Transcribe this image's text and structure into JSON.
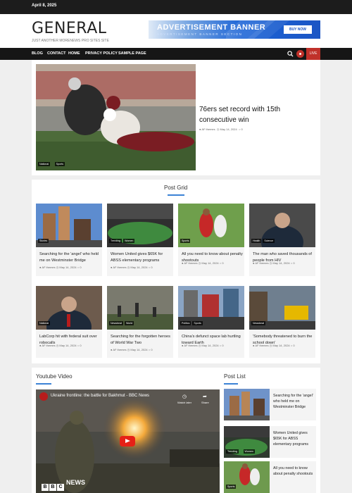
{
  "topbar": {
    "date": "April 8, 2025"
  },
  "header": {
    "logo": "GENERAL",
    "tagline": "Just another morenews pro sites site",
    "ad": {
      "title": "ADVERTISEMENT BANNER",
      "subtitle": "ADVERTISEMENT BANNER SECTION",
      "button": "BUY NOW"
    }
  },
  "nav": {
    "items": [
      "BLOG",
      "CONTACT",
      "HOME",
      "PRIVACY POLICY",
      "SAMPLE PAGE"
    ],
    "live_label": "LIVE"
  },
  "featured": {
    "title": "76ers set record with 15th consecutive win",
    "author": "AF themes",
    "date": "May 14, 2024",
    "comments": "0",
    "tags": [
      "National",
      "Sports"
    ]
  },
  "post_grid": {
    "title": "Post Grid",
    "cards": [
      {
        "title": "Searching for the 'angel' who held me on Westminster Bridge",
        "tags": [
          "Stories"
        ],
        "author": "AF themes",
        "date": "May 14, 2024",
        "comments": "0"
      },
      {
        "title": "Women United gives $65K for ABSS elementary programs",
        "tags": [
          "Trending",
          "Women"
        ],
        "author": "AF themes",
        "date": "May 14, 2024",
        "comments": "0"
      },
      {
        "title": "All you need to know about penalty shootouts",
        "tags": [
          "Sports"
        ],
        "author": "AF themes",
        "date": "May 14, 2024",
        "comments": "0"
      },
      {
        "title": "The man who saved thousands of people from HIV",
        "tags": [
          "Health",
          "Science"
        ],
        "author": "AF themes",
        "date": "May 14, 2024",
        "comments": "0"
      },
      {
        "title": "LabCorp hit with federal suit over robocalls",
        "tags": [
          "National"
        ],
        "author": "AF themes",
        "date": "May 14, 2024",
        "comments": "0"
      },
      {
        "title": "Searching for the forgotten heroes of World War Two",
        "tags": [
          "Newsbeat",
          "World"
        ],
        "author": "AF themes",
        "date": "May 14, 2024",
        "comments": "0"
      },
      {
        "title": "China's defunct space lab hurtling toward Earth",
        "tags": [
          "Politics",
          "Sports"
        ],
        "author": "AF themes",
        "date": "May 14, 2024",
        "comments": "0"
      },
      {
        "title": "'Somebody threatened to burn the school down'",
        "tags": [
          "Newsbeat"
        ],
        "author": "AF themes",
        "date": "May 14, 2024",
        "comments": "0"
      }
    ]
  },
  "youtube": {
    "section_title": "Youtube Video",
    "video_title": "Ukraine frontline: the battle for Bakhmut - BBC News",
    "watch_later": "Watch later",
    "share": "Share",
    "channel_badge": "BBC NEWS",
    "bbc_letters": [
      "B",
      "B",
      "C"
    ],
    "news_label": "NEWS"
  },
  "post_list": {
    "title": "Post List",
    "items": [
      {
        "title": "Searching for the 'angel' who held me on Westminster Bridge",
        "tags": []
      },
      {
        "title": "Women United gives $65K for ABSS elementary programs",
        "tags": [
          "Trending",
          "Women"
        ]
      },
      {
        "title": "All you need to know about penalty shootouts",
        "tags": [
          "Sports"
        ]
      }
    ]
  },
  "colors": {
    "accent": "#3b82d6",
    "live": "#c0312a",
    "nav": "#161616",
    "ad": "#1b55c4"
  }
}
